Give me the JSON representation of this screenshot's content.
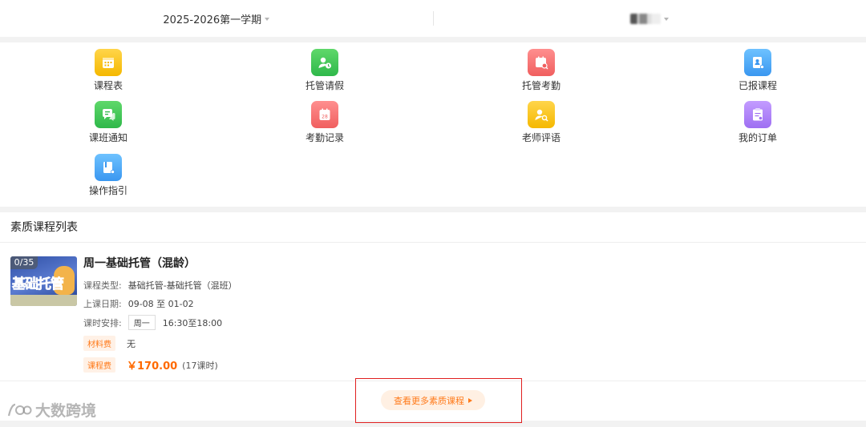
{
  "header": {
    "term_selector": "2025-2026第一学期",
    "student_selector_blurred": true
  },
  "menu": [
    {
      "label": "课程表",
      "icon": "calendar-icon",
      "color": "#f7c21a"
    },
    {
      "label": "托管请假",
      "icon": "person-clock-icon",
      "color": "#3fc55a"
    },
    {
      "label": "托管考勤",
      "icon": "calendar-search-icon",
      "color": "#f56c6c"
    },
    {
      "label": "已报课程",
      "icon": "book-user-icon",
      "color": "#4aa8f5"
    },
    {
      "label": "课班通知",
      "icon": "chat-bubble-icon",
      "color": "#3fc55a"
    },
    {
      "label": "考勤记录",
      "icon": "calendar-date-icon",
      "color": "#f56c6c"
    },
    {
      "label": "老师评语",
      "icon": "person-search-icon",
      "color": "#f7c21a"
    },
    {
      "label": "我的订单",
      "icon": "clipboard-order-icon",
      "color": "#a77ef5"
    },
    {
      "label": "操作指引",
      "icon": "book-guide-icon",
      "color": "#4aa8f5"
    }
  ],
  "section": {
    "title": "素质课程列表"
  },
  "course": {
    "thumb_count": "0/35",
    "thumb_title": "基础托管",
    "name": "周一基础托管（混龄）",
    "type_label": "课程类型:",
    "type_value": "基础托管-基础托管（混班）",
    "date_label": "上课日期:",
    "date_value": "09-08 至 01-02",
    "schedule_label": "课时安排:",
    "schedule_day": "周一",
    "schedule_time": "16:30至18:00",
    "material_tag": "材料费",
    "material_value": "无",
    "fee_tag": "课程费",
    "fee_price": "￥170.00",
    "fee_note": "(17课时)"
  },
  "more_button": "查看更多素质课程",
  "watermark": "大数跨境"
}
